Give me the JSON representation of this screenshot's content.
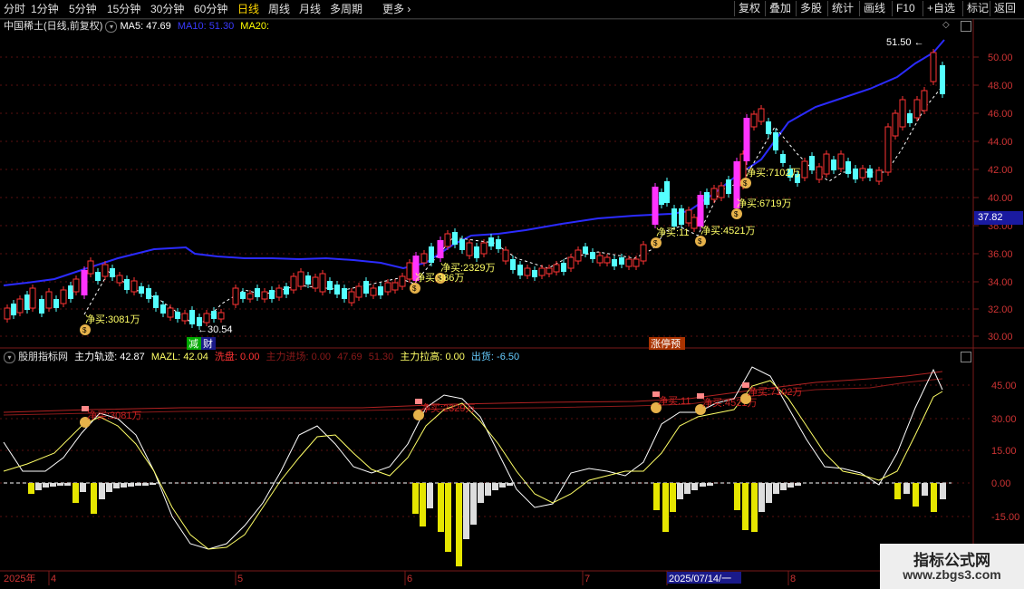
{
  "toolbar": {
    "periods": [
      "分时",
      "1分钟",
      "5分钟",
      "15分钟",
      "30分钟",
      "60分钟",
      "日线",
      "周线",
      "月线",
      "多周期",
      "更多"
    ],
    "active_period": "日线",
    "right_buttons": [
      "复权",
      "叠加",
      "多股",
      "统计",
      "画线",
      "F10",
      "+自选",
      "返回"
    ],
    "more_arrow": "›"
  },
  "main_chart": {
    "title": "中国稀土(日线,前复权)",
    "ma5_label": "MA5: 47.69",
    "ma10_label": "MA10: 51.30",
    "ma20_label": "MA20:",
    "ma5_color": "#ffffff",
    "ma10_color": "#3a3aff",
    "ma20_color": "#ffff00",
    "price_ticks": [
      "50.00",
      "48.00",
      "46.00",
      "44.00",
      "42.00",
      "40.00",
      "38.00",
      "36.00",
      "34.00",
      "32.00",
      "30.00"
    ],
    "current_price_tag": "37.82",
    "high_label": "51.50",
    "low_label": "30.54",
    "net_buy_labels": [
      "净买:3081万",
      "净买:2329万",
      "净买:386万",
      "净买:11",
      "净买:4521万",
      "净买:6719万",
      "净买:7102万"
    ],
    "markers": [
      "减",
      "财",
      "涨停预"
    ]
  },
  "indicator_panel": {
    "name": "股朋指标网",
    "items": [
      {
        "label": "主力轨迹:",
        "value": "42.87",
        "color": "#ffffff"
      },
      {
        "label": "MAZL:",
        "value": "42.04",
        "color": "#ffff66"
      },
      {
        "label": "洗盘:",
        "value": "0.00",
        "color": "#ff3333"
      },
      {
        "label": "主力进场:",
        "value": "0.00",
        "color": "#8b1a1a"
      },
      {
        "label": "",
        "value": "47.69",
        "color": "#8b1a1a"
      },
      {
        "label": "",
        "value": "51.30",
        "color": "#8b1a1a"
      },
      {
        "label": "主力拉高:",
        "value": "0.00",
        "color": "#ffff66"
      },
      {
        "label": "出货:",
        "value": "-6.50",
        "color": "#66ccff"
      }
    ],
    "y_ticks": [
      "45.00",
      "30.00",
      "15.00",
      "0.00",
      "-15.00"
    ],
    "overlay_labels": [
      "净买:3081万",
      "净买:2329万",
      "净买:11",
      "净买:4521万",
      "净买:7102万"
    ]
  },
  "time_axis": {
    "labels": [
      "2025年",
      "4",
      "5",
      "6",
      "7",
      "2025/07/14/一",
      "8"
    ]
  },
  "watermark": {
    "line1": "指标公式网",
    "line2": "www.zbgs3.com"
  }
}
